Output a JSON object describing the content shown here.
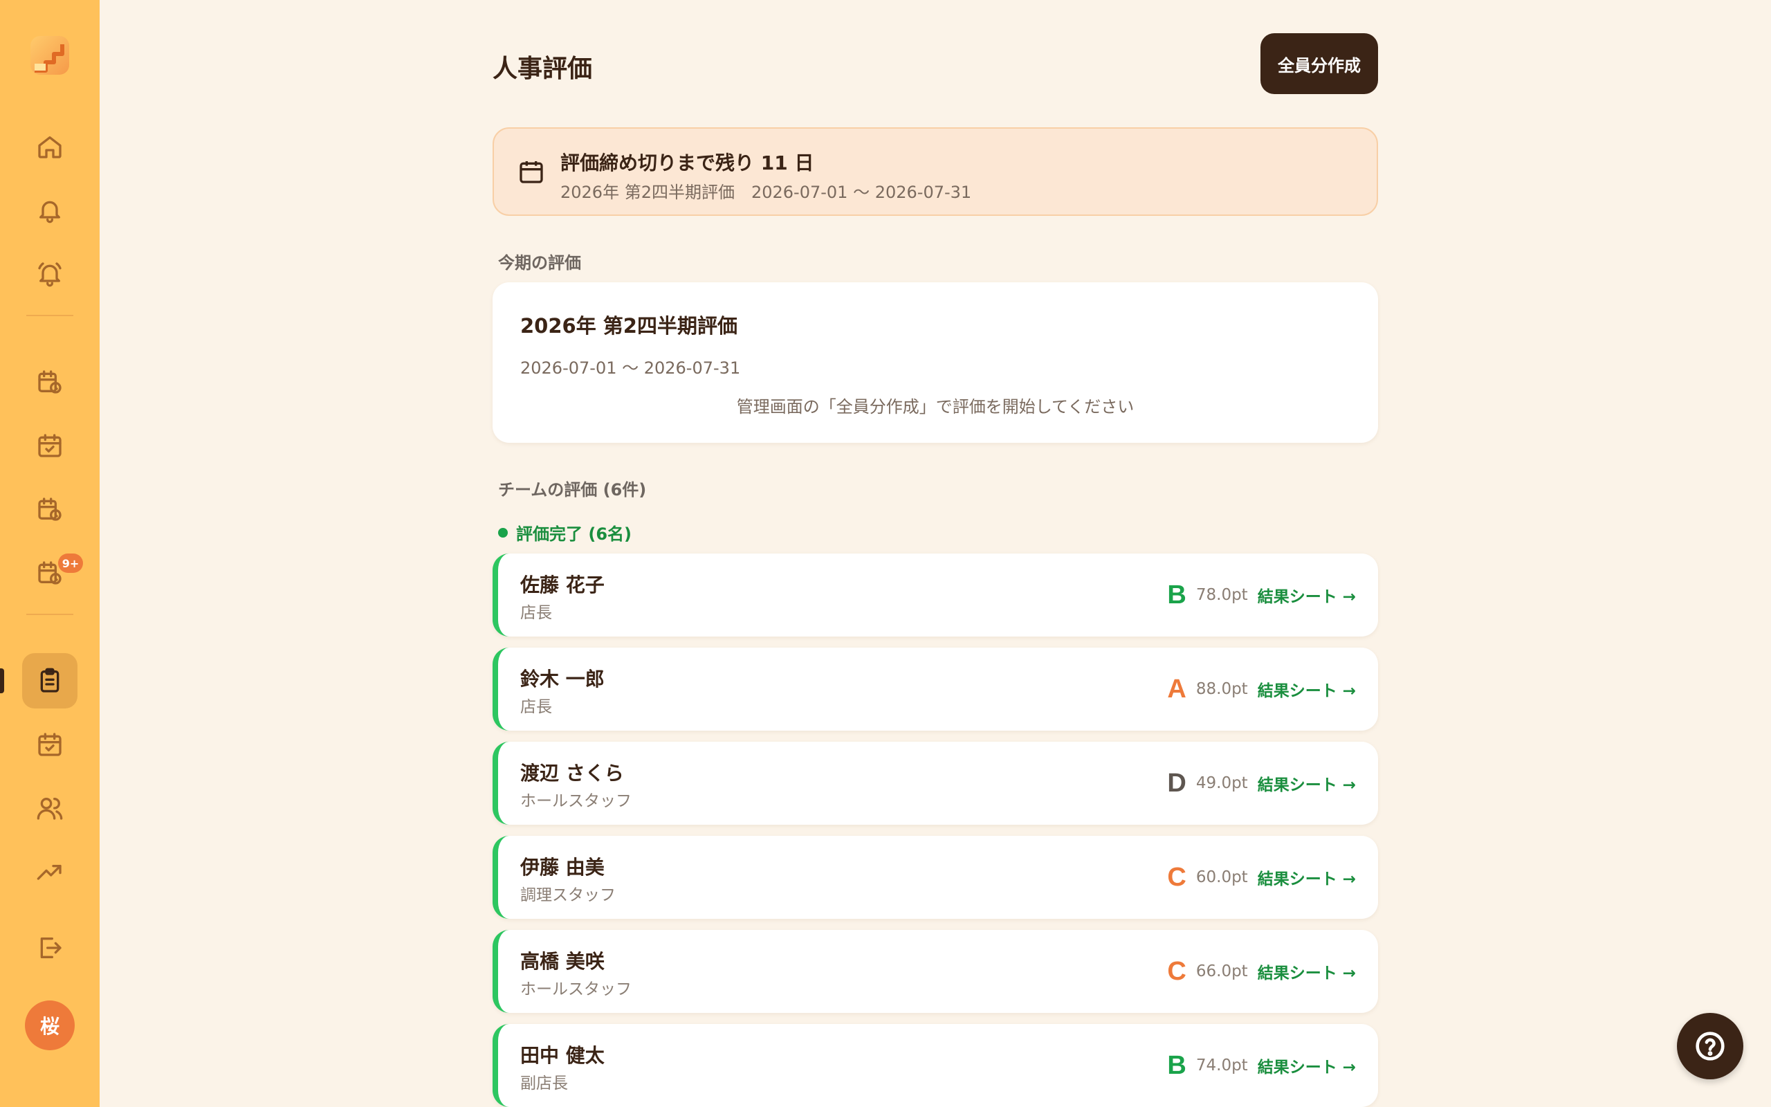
{
  "sidebar": {
    "avatar_initial": "桜",
    "badge_count": "9+",
    "icons": [
      "home-icon",
      "bell-icon",
      "bell-ring-icon",
      "calendar-clock-icon",
      "calendar-check-icon",
      "calendar-clock-icon",
      "calendar-clock-icon",
      "clipboard-icon",
      "calendar-check-icon",
      "users-icon",
      "trending-up-icon",
      "logout-icon"
    ]
  },
  "header": {
    "title": "人事評価",
    "create_all_label": "全員分作成"
  },
  "deadline": {
    "title": "評価締め切りまで残り 11 日",
    "subtitle": "2026年 第2四半期評価　2026-07-01 〜 2026-07-31"
  },
  "current": {
    "section_label": "今期の評価",
    "title": "2026年 第2四半期評価",
    "range": "2026-07-01 〜 2026-07-31",
    "message": "管理画面の「全員分作成」で評価を開始してください"
  },
  "team": {
    "section_label": "チームの評価 (6件)",
    "status_label": "評価完了 (6名)",
    "link_label": "結果シート →",
    "members": [
      {
        "name": "佐藤 花子",
        "role": "店長",
        "grade": "B",
        "score": "78.0pt",
        "grade_color": "#1aa34a"
      },
      {
        "name": "鈴木 一郎",
        "role": "店長",
        "grade": "A",
        "score": "88.0pt",
        "grade_color": "#ee7a3a"
      },
      {
        "name": "渡辺 さくら",
        "role": "ホールスタッフ",
        "grade": "D",
        "score": "49.0pt",
        "grade_color": "#5e5650"
      },
      {
        "name": "伊藤 由美",
        "role": "調理スタッフ",
        "grade": "C",
        "score": "60.0pt",
        "grade_color": "#ee7a3a"
      },
      {
        "name": "高橋 美咲",
        "role": "ホールスタッフ",
        "grade": "C",
        "score": "66.0pt",
        "grade_color": "#ee7a3a"
      },
      {
        "name": "田中 健太",
        "role": "副店長",
        "grade": "B",
        "score": "74.0pt",
        "grade_color": "#1aa34a"
      }
    ]
  }
}
